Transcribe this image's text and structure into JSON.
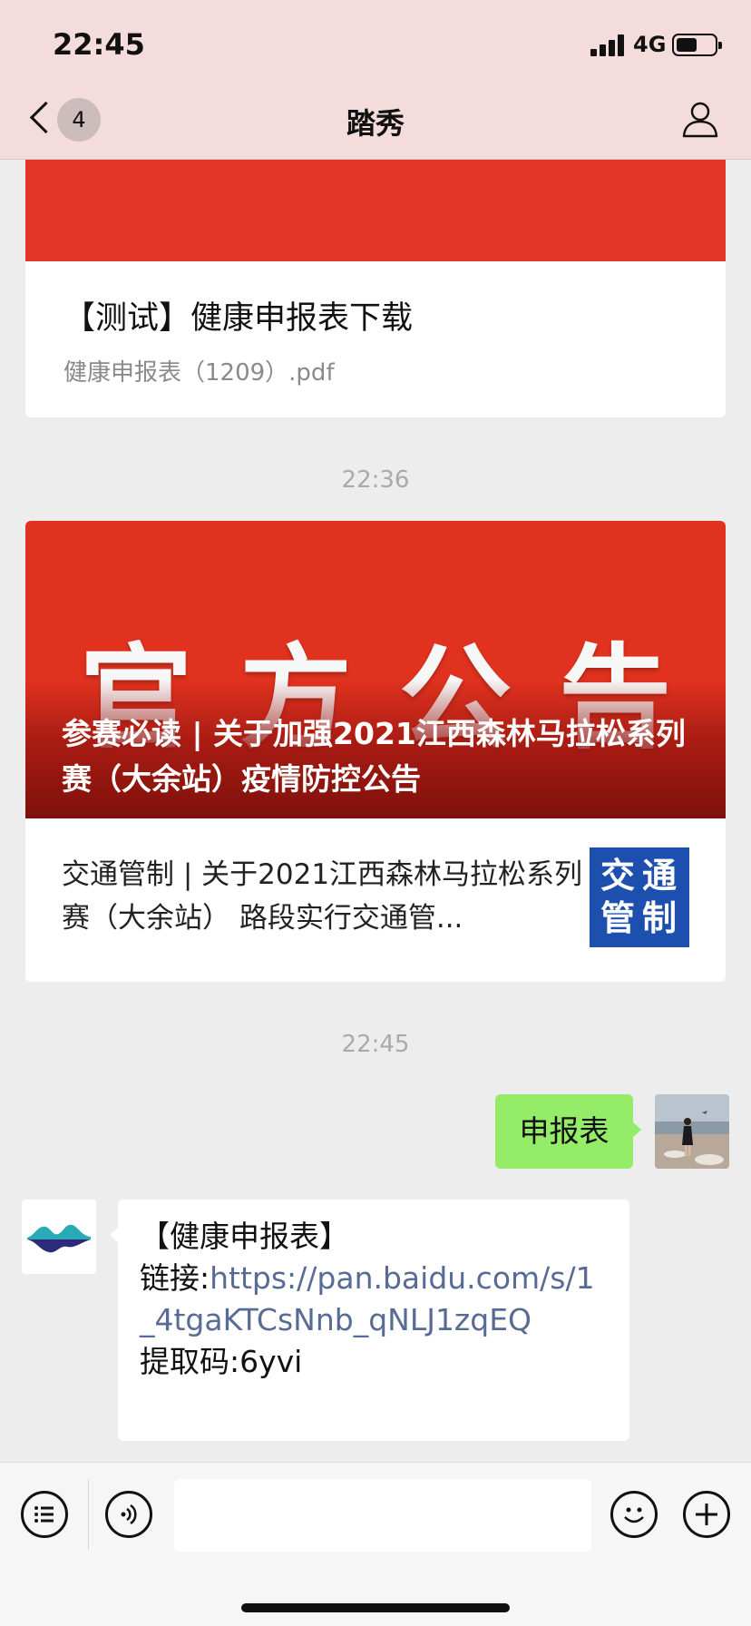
{
  "status_bar": {
    "time": "22:45",
    "network": "4G",
    "battery_level": 0.55,
    "signal_bars": 4
  },
  "header": {
    "unread_count": "4",
    "title": "踏秀",
    "back_icon": "chevron-left-icon",
    "profile_icon": "person-icon"
  },
  "feed": {
    "card1": {
      "title": "【测试】健康申报表下载",
      "subtitle": "健康申报表（1209）.pdf",
      "banner_color": "#e43427"
    },
    "time_1": "22:36",
    "card2": {
      "cover_big_text": "官方公告",
      "cover_caption": "参赛必读 | 关于加强2021江西森林马拉松系列赛（大余站）疫情防控公告",
      "desc": "交通管制 | 关于2021江西森林马拉松系列赛（大余站） 路段实行交通管...",
      "thumb_line1": "交通",
      "thumb_line2": "管制",
      "thumb_color": "#1d4fae"
    },
    "time_2": "22:45",
    "my_message": "申报表",
    "bot_message": {
      "line1": "【健康申报表】",
      "link_prefix": "链接:",
      "link_url": "https://pan.baidu.com/s/1_4tgaKTCsNnb_qNLJ1zqEQ",
      "code_line": "提取码:6yvi"
    }
  },
  "input_bar": {
    "menu_icon": "list-menu-icon",
    "voice_icon": "voice-icon",
    "emoji_icon": "emoji-icon",
    "plus_icon": "plus-icon"
  },
  "colors": {
    "header_bg": "#f4dcdc",
    "chat_bg": "#ededed",
    "my_bubble": "#95ec69",
    "link": "#576b95"
  }
}
